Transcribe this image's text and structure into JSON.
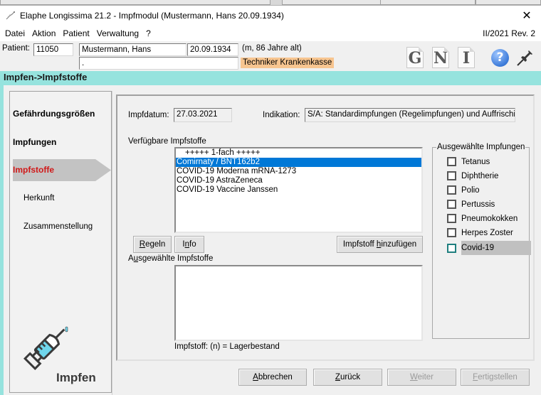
{
  "window": {
    "title": "Elaphe Longissima 21.2 - Impfmodul (Mustermann, Hans  20.09.1934)",
    "app_icon": "snake-icon",
    "close_icon": "close-icon",
    "close_glyph": "✕"
  },
  "menu": {
    "items": [
      "Datei",
      "Aktion",
      "Patient",
      "Verwaltung",
      "?"
    ],
    "version": "II/2021 Rev. 2"
  },
  "patient": {
    "label": "Patient:",
    "id": "11050",
    "name": "Mustermann, Hans",
    "birthdate": "20.09.1934",
    "info": "(m, 86 Jahre alt)",
    "address": ".",
    "insurance": "Techniker Krankenkasse",
    "insurance_color": "#f7c590"
  },
  "toolbar": {
    "icons": [
      {
        "name": "g-document-icon",
        "glyph": "G"
      },
      {
        "name": "n-document-icon",
        "glyph": "N"
      },
      {
        "name": "i-document-icon",
        "glyph": "I"
      }
    ],
    "help_glyph": "?",
    "help_icon": "help-icon",
    "pin_icon": "pin-icon"
  },
  "breadcrumb": "Impfen->Impfstoffe",
  "accent_color": "#96e3de",
  "sidebar": {
    "items": [
      {
        "label": "Gefährdungsgrößen",
        "state": "normal"
      },
      {
        "label": "Impfungen",
        "state": "normal"
      },
      {
        "label": "Impfstoffe",
        "state": "active"
      },
      {
        "label": "Herkunft",
        "state": "sub"
      },
      {
        "label": "Zusammenstellung",
        "state": "sub"
      }
    ],
    "active_color": "#d01818",
    "module_label": "Impfen",
    "module_icon": "syringe-icon"
  },
  "form": {
    "impfdatum_label": "Impfdatum:",
    "impfdatum_value": "27.03.2021",
    "indikation_label": "Indikation:",
    "indikation_value": "S/A:  Standardimpfungen (Regelimpfungen) und Auffrischimp",
    "available_label": "Verfügbare Impfstoffe",
    "available_items": [
      {
        "label": "+++++ 1-fach +++++",
        "type": "header"
      },
      {
        "label": "Comirnaty / BNT162b2",
        "type": "selected"
      },
      {
        "label": "COVID-19 Moderna mRNA-1273",
        "type": "item"
      },
      {
        "label": "COVID-19 AstraZeneca",
        "type": "item"
      },
      {
        "label": "COVID-19 Vaccine Janssen",
        "type": "item"
      }
    ],
    "regeln_button": {
      "mnemonic": "R",
      "rest": "egeln"
    },
    "info_button": {
      "pre": "I",
      "mnemonic": "n",
      "rest": "fo"
    },
    "add_button": {
      "pre": "Impfstoff ",
      "mnemonic": "h",
      "rest": "inzufügen"
    },
    "selected_label": {
      "pre": "A",
      "mnemonic": "u",
      "rest": "sgewählte Impfstoffe"
    },
    "selected_items": [],
    "legend_note": "Impfstoff: (n) = Lagerbestand"
  },
  "vaccinations_group": {
    "title": "Ausgewählte Impfungen",
    "items": [
      {
        "label": "Tetanus",
        "checked": false,
        "focused": false
      },
      {
        "label": "Diphtherie",
        "checked": false,
        "focused": false
      },
      {
        "label": "Polio",
        "checked": false,
        "focused": false
      },
      {
        "label": "Pertussis",
        "checked": false,
        "focused": false
      },
      {
        "label": "Pneumokokken",
        "checked": false,
        "focused": false
      },
      {
        "label": "Herpes Zoster",
        "checked": false,
        "focused": false
      },
      {
        "label": "Covid-19",
        "checked": false,
        "focused": true
      }
    ]
  },
  "footer": {
    "buttons": [
      {
        "name": "cancel-button",
        "mnemonic": "A",
        "rest": "bbrechen",
        "enabled": true
      },
      {
        "name": "back-button",
        "mnemonic": "Z",
        "rest": "urück",
        "enabled": true
      },
      {
        "name": "next-button",
        "mnemonic": "W",
        "rest": "eiter",
        "enabled": false
      },
      {
        "name": "finish-button",
        "mnemonic": "F",
        "rest": "ertigstellen",
        "enabled": false
      }
    ]
  }
}
